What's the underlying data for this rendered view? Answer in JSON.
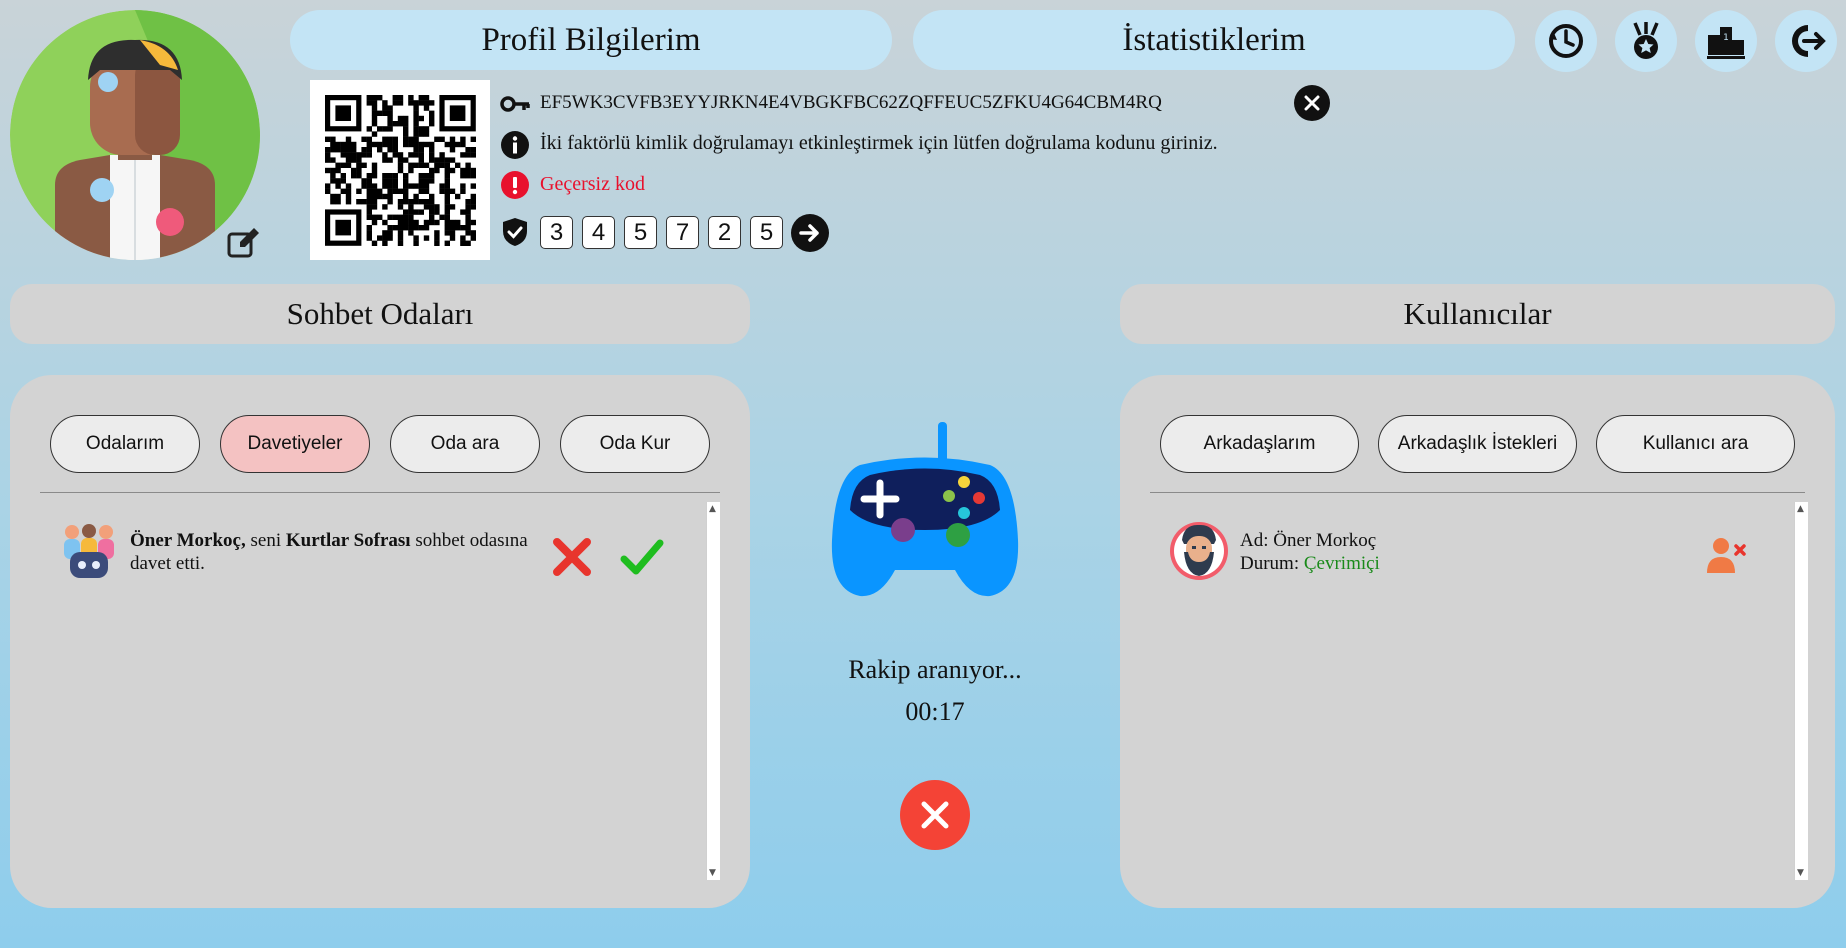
{
  "tabs": {
    "profile": "Profil Bilgilerim",
    "stats": "İstatistiklerim"
  },
  "header_icons": [
    "history-icon",
    "medal-icon",
    "leaderboard-icon",
    "logout-icon"
  ],
  "two_factor": {
    "secret_key": "EF5WK3CVFB3EYYJRKN4E4VBGKFBC62ZQFFEUC5ZFKU4G64CBM4RQ",
    "info_text": "İki faktörlü kimlik doğrulamayı etkinleştirmek için lütfen doğrulama kodunu giriniz.",
    "error_text": "Geçersiz kod",
    "code_digits": [
      "3",
      "4",
      "5",
      "7",
      "2",
      "5"
    ]
  },
  "chat_rooms": {
    "title": "Sohbet Odaları",
    "buttons": [
      "Odalarım",
      "Davetiyeler",
      "Oda ara",
      "Oda Kur"
    ],
    "active_button": "Davetiyeler",
    "invites": [
      {
        "inviter": "Öner Morkoç,",
        "text_before": " seni ",
        "room": "Kurtlar Sofrası",
        "text_after": " sohbet odasına davet etti."
      }
    ]
  },
  "matchmaking": {
    "status": "Rakip aranıyor...",
    "timer": "00:17"
  },
  "users": {
    "title": "Kullanıcılar",
    "buttons": [
      "Arkadaşlarım",
      "Arkadaşlık İstekleri",
      "Kullanıcı ara"
    ],
    "list": [
      {
        "name_label": "Ad:",
        "name": "Öner Morkoç",
        "status_label": "Durum:",
        "status": "Çevrimiçi"
      }
    ]
  },
  "colors": {
    "tab_bg": "#c3e4f5",
    "panel_bg": "#d3d3d3",
    "active_pill": "#f4c2c2",
    "error": "#e8112d",
    "online": "#1a8a1a",
    "cancel": "#f44336",
    "accept": "#1fbd1f"
  }
}
